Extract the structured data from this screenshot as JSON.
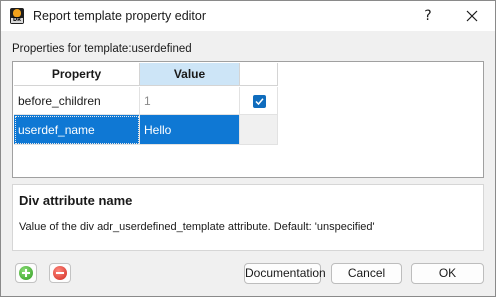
{
  "window": {
    "title": "Report template property editor",
    "help_label": "?",
    "icon": "app-logo-icon",
    "icon_tag": "DR"
  },
  "subtitle": "Properties for template:userdefined",
  "table": {
    "headers": [
      "Property",
      "Value",
      ""
    ],
    "rows": [
      {
        "property": "before_children",
        "value": "1",
        "checked": true,
        "value_muted": true
      },
      {
        "property": "userdef_name",
        "value": "Hello",
        "selected": true
      }
    ]
  },
  "description": {
    "title": "Div attribute name",
    "text": "Value of the div adr_userdefined_template attribute. Default: 'unspecified'"
  },
  "buttons": {
    "add_icon": "add-icon",
    "remove_icon": "remove-icon",
    "documentation": "Documentation",
    "cancel": "Cancel",
    "ok": "OK"
  },
  "colors": {
    "selection": "#0f78d4",
    "header_value_bg": "#cde5f7",
    "checkbox": "#0f6cbd"
  }
}
